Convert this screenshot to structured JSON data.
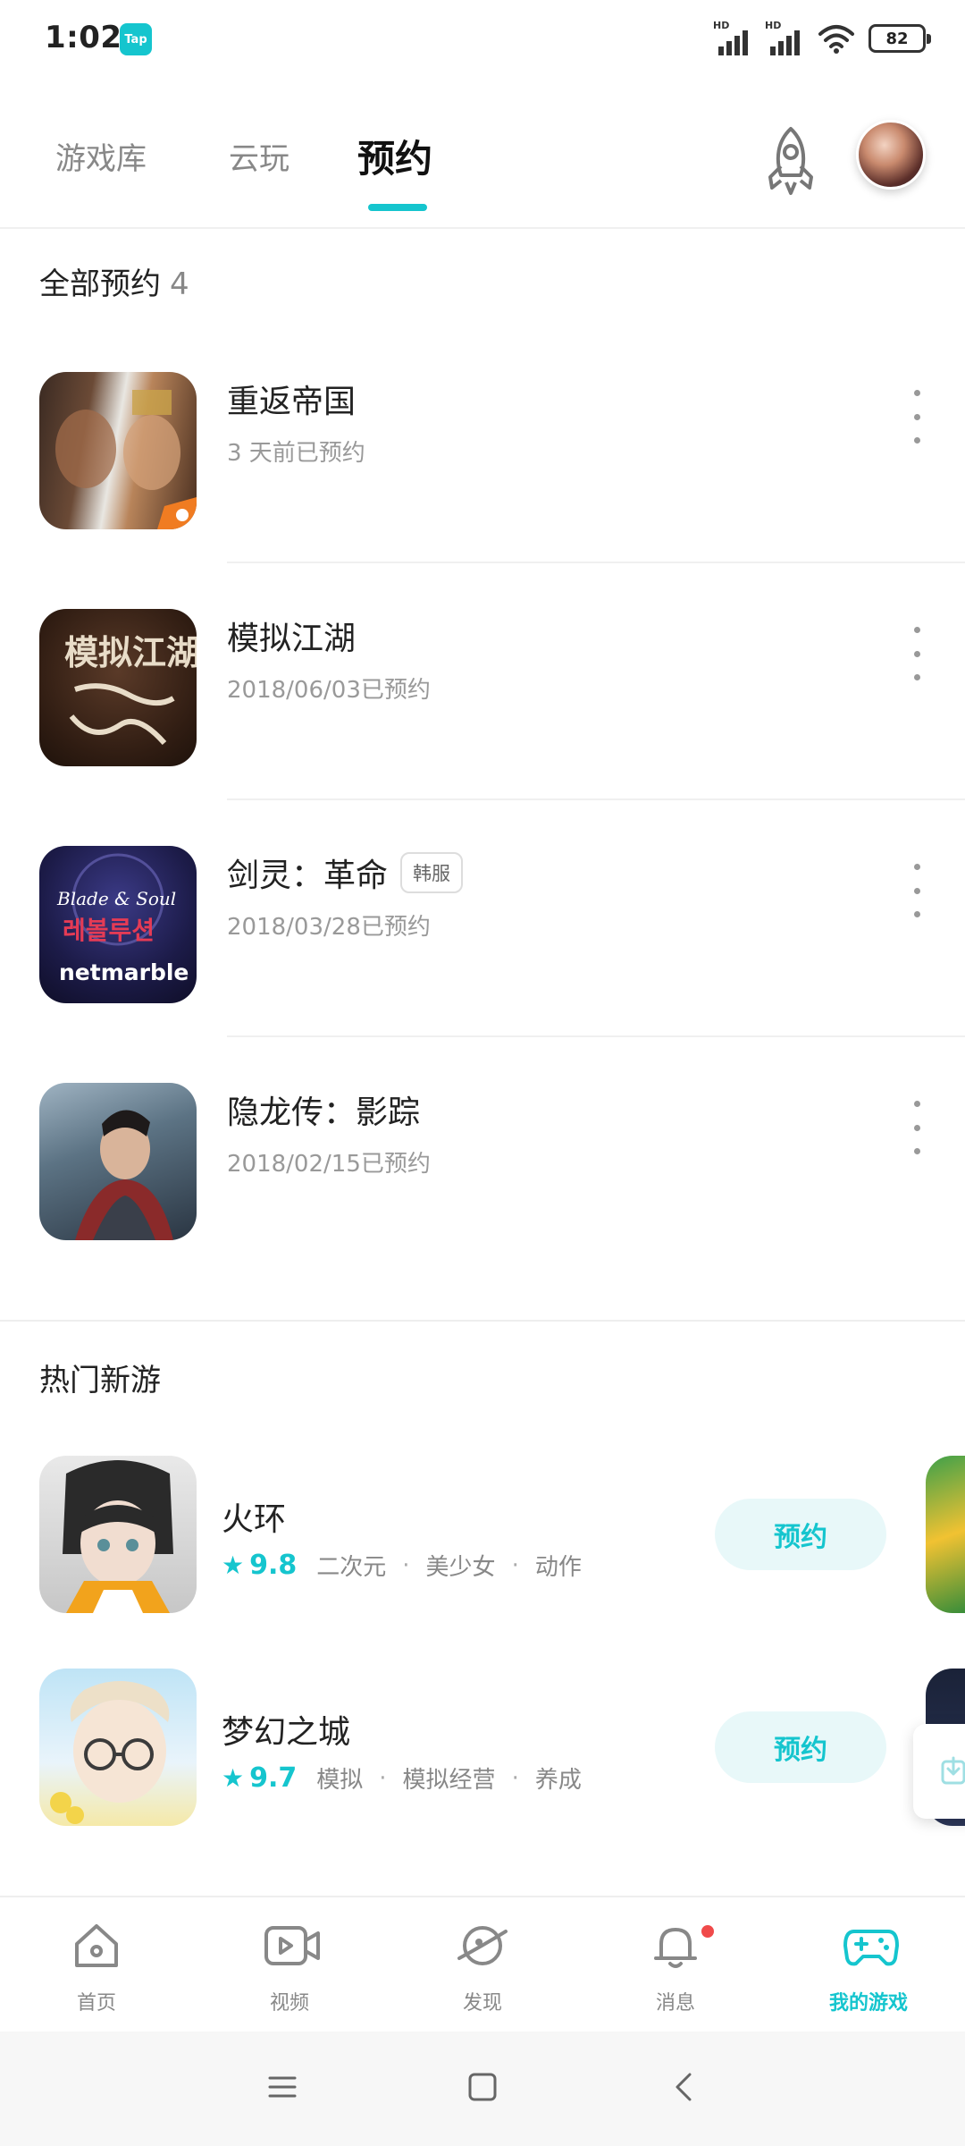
{
  "status_bar": {
    "time": "1:02",
    "tap_badge": "Tap",
    "battery": "82",
    "signal_label": "HD",
    "icons": [
      "signal-icon",
      "signal-icon",
      "wifi-icon",
      "battery-icon"
    ]
  },
  "top_nav": {
    "tabs": [
      {
        "label": "游戏库",
        "active": false
      },
      {
        "label": "云玩",
        "active": false
      },
      {
        "label": "预约",
        "active": true
      }
    ],
    "accent_color": "#15c5ce"
  },
  "reserved": {
    "title": "全部预约",
    "count": "4",
    "items": [
      {
        "name": "重返帝国",
        "date": "3 天前已预约",
        "tag": ""
      },
      {
        "name": "模拟江湖",
        "date": "2018/06/03已预约",
        "tag": ""
      },
      {
        "name": "剑灵：革命",
        "date": "2018/03/28已预约",
        "tag": "韩服"
      },
      {
        "name": "隐龙传：影踪",
        "date": "2018/02/15已预约",
        "tag": ""
      }
    ],
    "icon_texts": {
      "moni_jianghu": "模拟江湖",
      "bns_logo": "Blade & Soul",
      "bns_korean": "레볼루션",
      "netmarble": "netmarble"
    }
  },
  "hot": {
    "title": "热门新游",
    "items": [
      {
        "name": "火环",
        "score": "9.8",
        "tags": [
          "二次元",
          "美少女",
          "动作"
        ],
        "button": "预约"
      },
      {
        "name": "梦幻之城",
        "score": "9.7",
        "tags": [
          "模拟",
          "模拟经营",
          "养成"
        ],
        "button": "预约"
      }
    ]
  },
  "bottom_nav": {
    "items": [
      {
        "label": "首页",
        "icon": "home-icon",
        "active": false
      },
      {
        "label": "视频",
        "icon": "video-icon",
        "active": false
      },
      {
        "label": "发现",
        "icon": "discover-icon",
        "active": false
      },
      {
        "label": "消息",
        "icon": "bell-icon",
        "active": false,
        "badge": true
      },
      {
        "label": "我的游戏",
        "icon": "gamepad-icon",
        "active": true
      }
    ]
  },
  "system_nav": {
    "icons": [
      "menu-icon",
      "home-square-icon",
      "back-icon"
    ]
  }
}
